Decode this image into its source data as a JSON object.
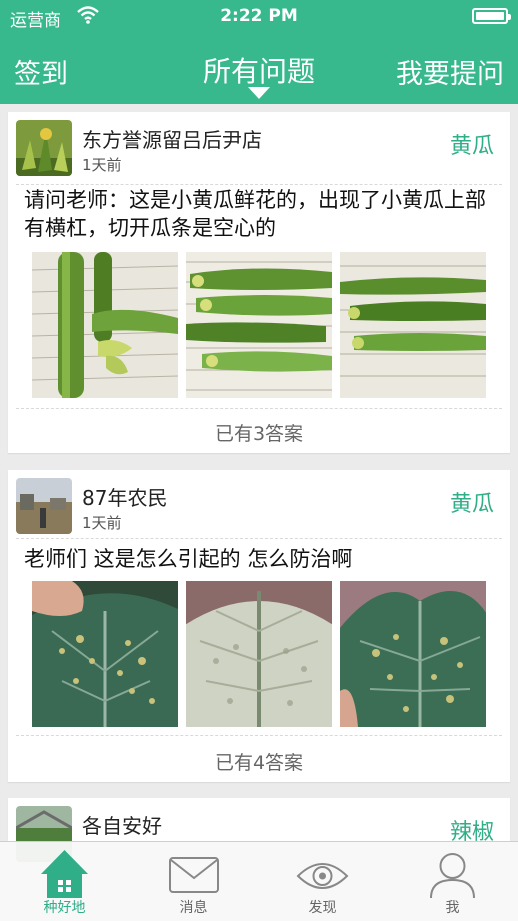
{
  "status_bar": {
    "carrier": "运营商",
    "time": "2:22 PM"
  },
  "nav": {
    "left": "签到",
    "title": "所有问题",
    "right": "我要提问"
  },
  "posts": [
    {
      "author": "东方誉源留吕后尹店",
      "age": "1天前",
      "tag": "黄瓜",
      "question": "请问老师：这是小黄瓜鲜花的，出现了小黄瓜上部有横杠，切开瓜条是空心的",
      "answers": "已有3答案"
    },
    {
      "author": "87年农民",
      "age": "1天前",
      "tag": "黄瓜",
      "question": "老师们   这是怎么引起的   怎么防治啊",
      "answers": "已有4答案"
    },
    {
      "author": "各自安好",
      "tag": "辣椒"
    }
  ],
  "tabs": [
    {
      "label": "种好地",
      "icon": "home-icon",
      "active": true
    },
    {
      "label": "消息",
      "icon": "envelope-icon",
      "active": false
    },
    {
      "label": "发现",
      "icon": "eye-icon",
      "active": false
    },
    {
      "label": "我",
      "icon": "person-icon",
      "active": false
    }
  ],
  "colors": {
    "brand": "#38b98d",
    "tag": "#2fae87",
    "background": "#ebebeb"
  }
}
